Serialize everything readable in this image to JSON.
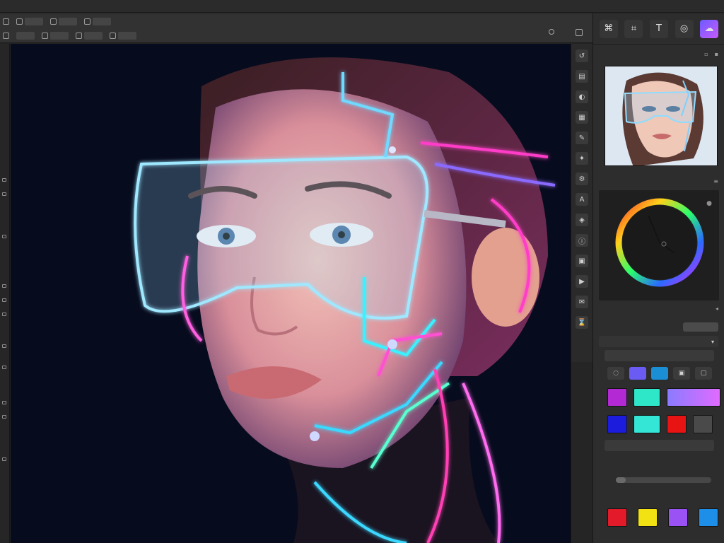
{
  "menubar": {
    "items": []
  },
  "optionsbar": {
    "row1": [],
    "row2": []
  },
  "canvas": {
    "art_label": ""
  },
  "right_toolbar": {
    "tools": [
      {
        "icon": "lasso-icon",
        "glyph": "⌘"
      },
      {
        "icon": "crop-icon",
        "glyph": "⌗"
      },
      {
        "icon": "type-tool-icon",
        "glyph": "T"
      },
      {
        "icon": "shape-icon",
        "glyph": "◎"
      },
      {
        "icon": "color-cloud-icon",
        "glyph": "☁"
      }
    ]
  },
  "panels": {
    "navigator": {
      "title": ""
    },
    "color": {
      "title": ""
    },
    "color_sub": {
      "title": ""
    },
    "blend": {
      "label": "",
      "button": ""
    },
    "gradient_head": {
      "label": ""
    },
    "opacity_row": {
      "label": "",
      "value": ""
    },
    "gradient_field": {
      "label": ""
    },
    "smoothness": {
      "label": ""
    },
    "swatches": {
      "label": ""
    }
  },
  "colors": {
    "accent": "#6d5bff",
    "swatch_row1": [
      "#b32ad4",
      "#2ee6c8",
      "#8a7bff"
    ],
    "swatch_row2": [
      "#1c1cdc",
      "#33e6d6",
      "#e81414",
      "#4a4a4a"
    ],
    "swatch_row3": [
      "#e31a2a",
      "#f2e213",
      "#9b52f5",
      "#1e8fe8"
    ],
    "tab_swatches": [
      "#6a5cf2",
      "#1b8fd6"
    ]
  }
}
